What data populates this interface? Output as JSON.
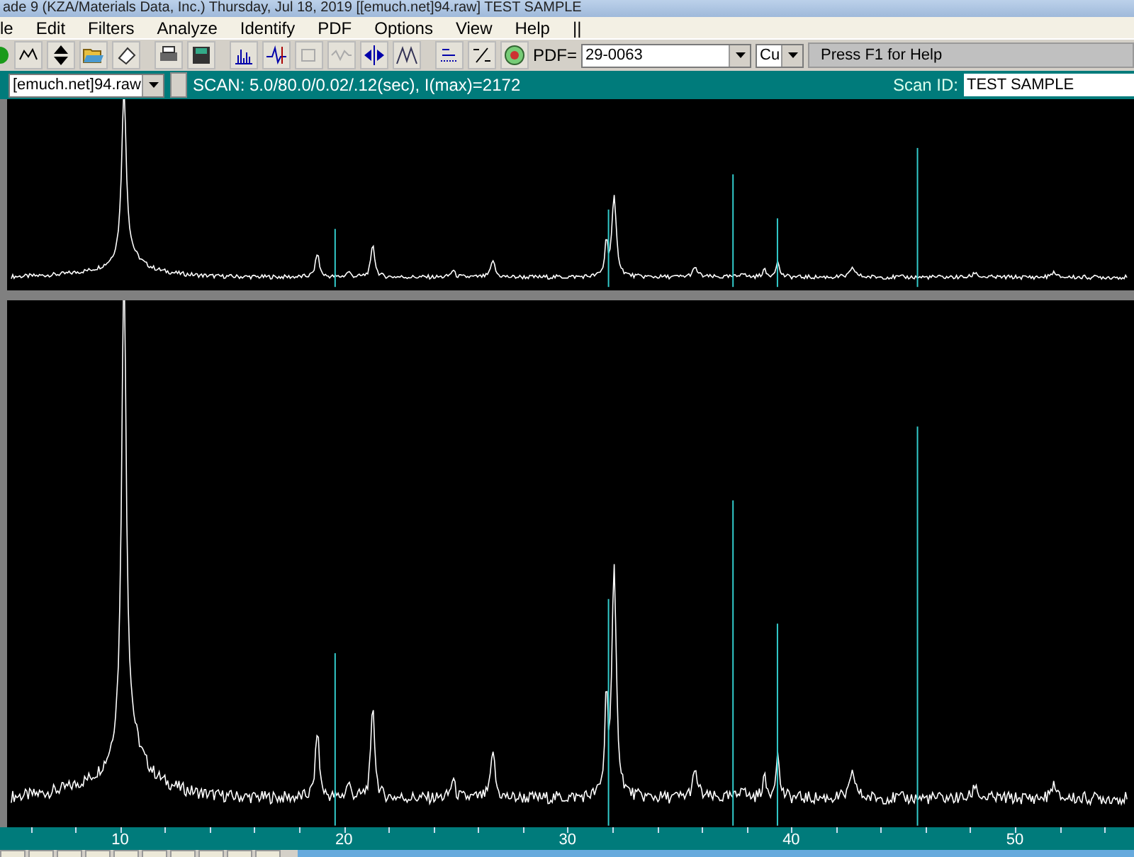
{
  "window": {
    "title": "ade 9 (KZA/Materials Data, Inc.) Thursday, Jul 18, 2019 [[emuch.net]94.raw] TEST SAMPLE"
  },
  "menu": [
    "le",
    "Edit",
    "Filters",
    "Analyze",
    "Identify",
    "PDF",
    "Options",
    "View",
    "Help",
    "||"
  ],
  "toolbar": {
    "pdf_label": "PDF=",
    "pdf_number": "29-0063",
    "anode": "Cu",
    "status": "Press F1 for Help"
  },
  "scan_bar": {
    "file": "[emuch.net]94.raw",
    "scan_info": "SCAN: 5.0/80.0/0.02/.12(sec), I(max)=2172",
    "scan_id_label": "Scan ID:",
    "scan_id": "TEST SAMPLE"
  },
  "axis": {
    "ticks": [
      "10",
      "20",
      "30",
      "40",
      "50"
    ]
  }
}
